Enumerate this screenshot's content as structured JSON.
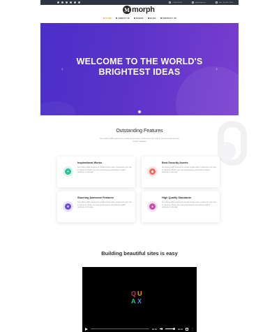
{
  "topbar": {
    "socials": [
      "facebook-icon",
      "twitter-icon",
      "google-plus-icon",
      "linkedin-icon",
      "rss-icon",
      "pinterest-icon"
    ],
    "contact": [
      {
        "icon": "phone-icon",
        "text": "+1 800 000 000"
      },
      {
        "icon": "mail-icon",
        "text": "info@morph.com"
      },
      {
        "icon": "clock-icon",
        "text": "Mon - Sat 9:00 - 18:00"
      }
    ]
  },
  "header": {
    "logo_mark": "M",
    "logo_text": "morph",
    "nav": [
      {
        "label": "HOME",
        "active": true
      },
      {
        "label": "ABOUT US",
        "active": false
      },
      {
        "label": "PAGES",
        "active": false
      },
      {
        "label": "BLOG",
        "active": false
      },
      {
        "label": "CONTACT US",
        "active": false
      }
    ]
  },
  "hero": {
    "title_line1": "WELCOME TO THE WORLD'S",
    "title_line2": "BRIGHTEST IDEAS",
    "prev": "‹",
    "next": "›"
  },
  "features": {
    "title": "Outstanding Features",
    "subtitle": "No coding skills required to create unique sites. Customize your site in real time and see the results instantly.",
    "cards": [
      {
        "title": "Inspirational Works",
        "text": "No coding skills required to create unique sites. Customize your site in real-time. Boost your site performance and achieve higher rankings on Google.",
        "icon": "lightbulb-icon",
        "color": "#2fbf9a",
        "glyph": "✦"
      },
      {
        "title": "Best Security Assets",
        "text": "No coding skills required to create unique sites. Customize your site in real-time. Boost your site performance and achieve higher rankings on Google.",
        "icon": "shield-icon",
        "color": "#f06a5f",
        "glyph": "◆"
      },
      {
        "title": "Stunning Awesome Features",
        "text": "No coding skills required to create unique sites. Customize your site in real-time. Boost your site performance and achieve higher rankings on Google.",
        "icon": "star-icon",
        "color": "#6d4bd8",
        "glyph": "★"
      },
      {
        "title": "High Quality Standards",
        "text": "No coding skills required to create unique sites. Customize your site in real-time. Boost your site performance and achieve higher rankings on Google.",
        "icon": "badge-icon",
        "color": "#c84fa8",
        "glyph": "●"
      }
    ]
  },
  "video_section": {
    "title": "Building beautiful sites is easy",
    "current_time": "00:00",
    "total_time": "00:25"
  },
  "colors": {
    "accent": "#f2a21b",
    "hero_start": "#4a2fc9",
    "hero_end": "#7a3fcf"
  }
}
